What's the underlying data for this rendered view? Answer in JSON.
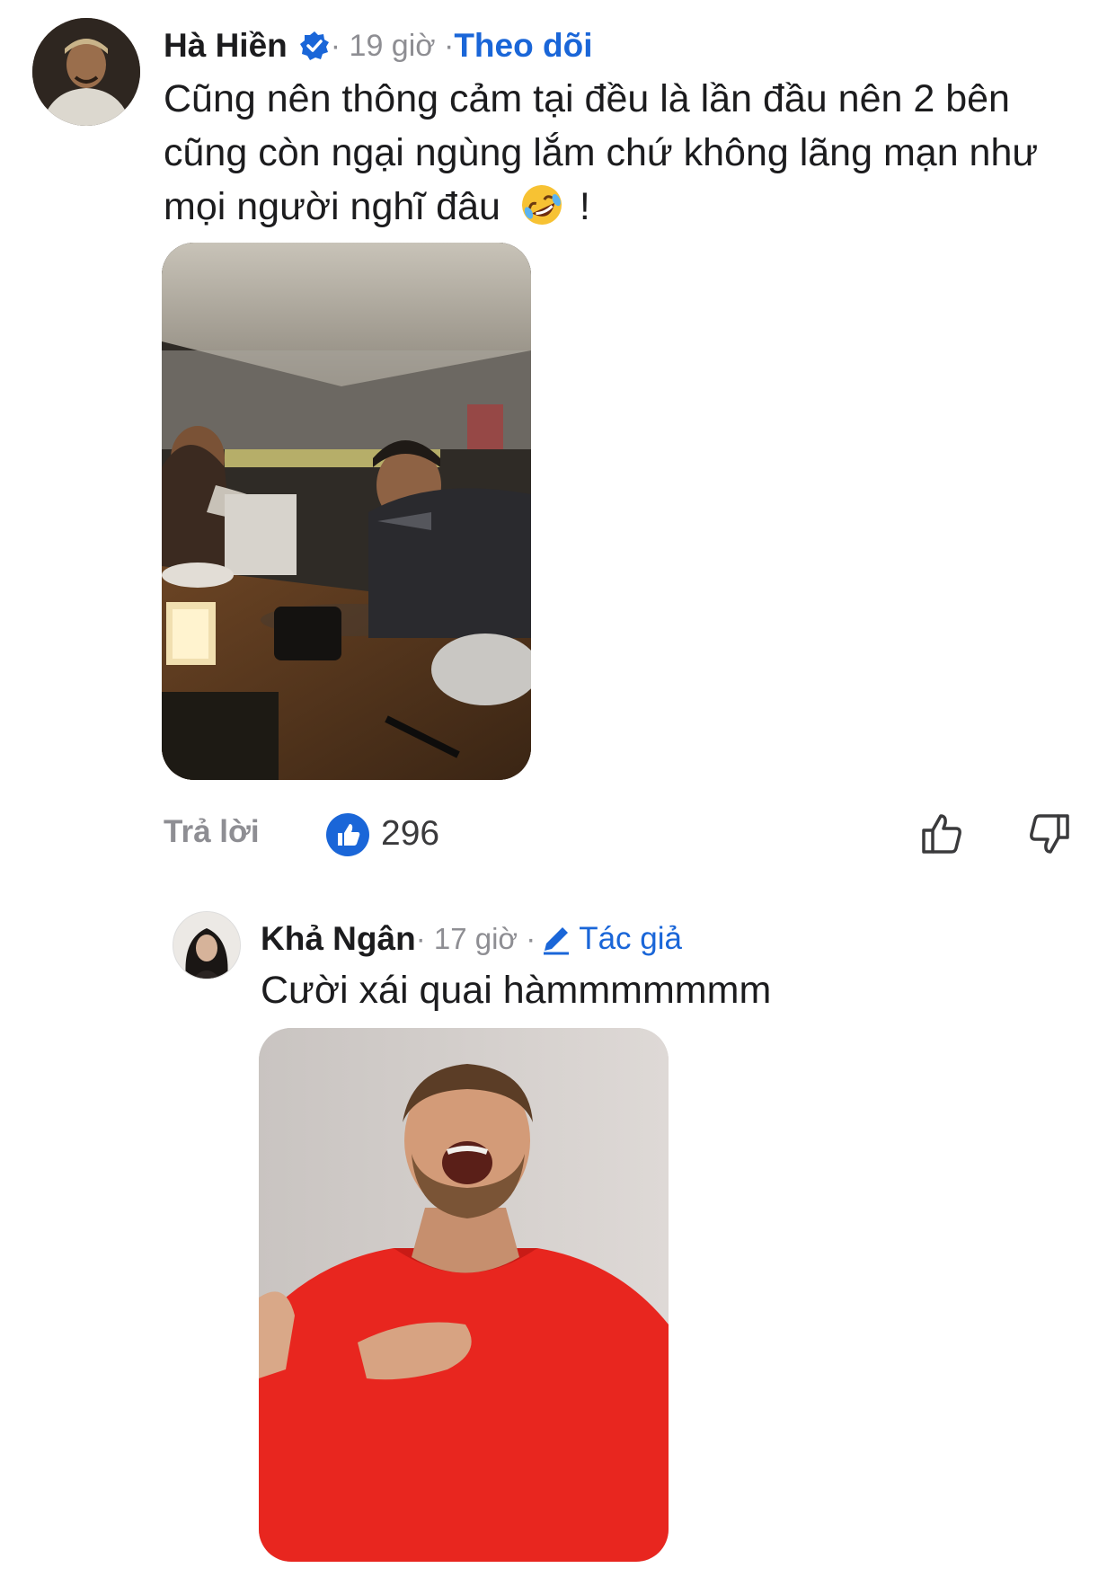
{
  "comment": {
    "author": "Hà Hiền",
    "verified_icon": "verified-badge-icon",
    "time": " · 19 giờ · ",
    "follow_label": "Theo dõi",
    "text": "Cũng nên thông cảm tại đều là lần đầu nên 2 bên cũng còn ngại ngùng lắm chứ không lãng mạn như mọi người nghĩ đâu",
    "emoji": "rolling-on-floor-laughing-emoji",
    "text_suffix": "!",
    "reply_label": "Trả lời",
    "like_count": "296",
    "colors": {
      "accent": "#1a66d8",
      "muted": "#8e8e93"
    }
  },
  "reply": {
    "author": "Khả Ngân",
    "time": " · 17 giờ · ",
    "author_badge": "Tác giả",
    "text": "Cười xái quai hàmmmmmmm"
  }
}
